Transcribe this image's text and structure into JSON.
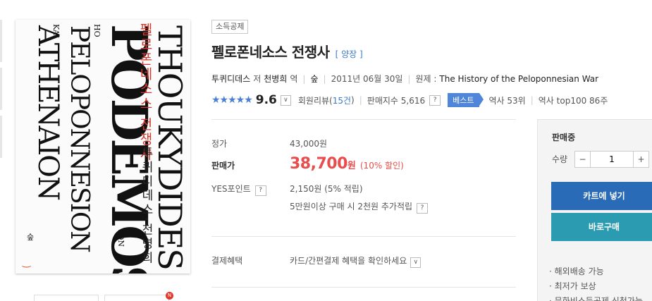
{
  "product": {
    "tax_badge": "소득공제",
    "title": "펠로폰네소스 전쟁사",
    "binding": "[ 양장 ]",
    "author": "투퀴디데스",
    "author_role": "저",
    "translator": "천병희",
    "translator_role": "역",
    "publisher": "숲",
    "pub_date": "2011년 06월 30일",
    "original_label": "원제 :",
    "original_title": "The History of the Peloponnesian War",
    "stars": "★★★★★",
    "score": "9.6",
    "review_label": "회원리뷰(",
    "review_count": "15건",
    "review_close": ")",
    "sales_index": "판매지수 5,616",
    "best_badge": "베스트",
    "rank_history": "역사 53위",
    "rank_top100": "역사 top100 86주"
  },
  "cover": {
    "title_kr": "펠로폰네소스 전쟁사",
    "author_kr": "투퀴디데스·천병희",
    "en_line1": "THOUKYDIDES",
    "en_line2": "PODEMOS",
    "en_line3": "PELOPONNESION",
    "en_line4": "ATHENAION",
    "small_ton": "TON",
    "small_ho": "HO",
    "small_kai": "KAI",
    "logo_mark": "‿",
    "logo_small": "숲"
  },
  "price": {
    "list_label": "정가",
    "list_price": "43,000원",
    "sale_label": "판매가",
    "sale_price": "38,700",
    "sale_won": "원",
    "discount": "(10% 할인)",
    "points_label": "YES포인트",
    "points": "2,150원 (5% 적립)",
    "extra_points": "5만원이상 구매 시 2천원 추가적립",
    "payment_label": "결제혜택",
    "payment_text": "카드/간편결제 혜택을 확인하세요"
  },
  "panel": {
    "status": "판매중",
    "qty_label": "수량",
    "qty_minus": "−",
    "qty_plus": "+",
    "qty_value": "1",
    "cart_button": "카트에 넣기",
    "buy_button": "바로구매",
    "link1": "· 해외배송 가능",
    "link2": "· 최저가 보상",
    "link3": "· 문화비소득공제 신청가능"
  },
  "icons": {
    "question": "?",
    "dropdown": "∨",
    "new_badge": "N"
  },
  "colors": {
    "accent_blue": "#2a6bb8",
    "buy_teal": "#2a9bb1",
    "sale_red": "#e94c4c",
    "link_blue": "#3a79c7",
    "star_blue": "#4a7fd4"
  }
}
